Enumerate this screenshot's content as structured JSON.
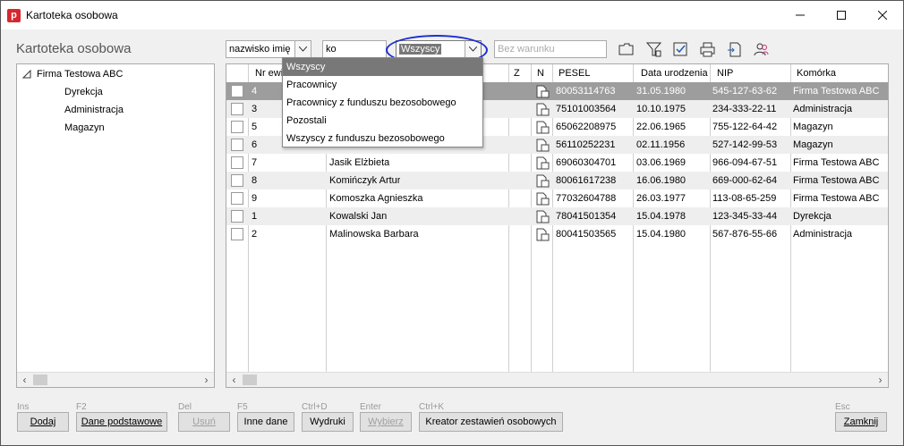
{
  "window": {
    "title": "Kartoteka osobowa"
  },
  "section_title": "Kartoteka osobowa",
  "filters": {
    "field_select": "nazwisko imię",
    "search_value": "ko",
    "group_select": "Wszyscy",
    "condition_placeholder": "Bez warunku"
  },
  "toolbar_icons": [
    "folder-icon",
    "filter-icon",
    "checkbox-icon",
    "print-icon",
    "export-icon",
    "users-icon"
  ],
  "tree": {
    "root": "Firma Testowa ABC",
    "children": [
      "Dyrekcja",
      "Administracja",
      "Magazyn"
    ]
  },
  "grid": {
    "columns": [
      "Nr ewid",
      "Z",
      "N",
      "PESEL",
      "Data urodzenia",
      "NIP",
      "Komórka"
    ],
    "rows": [
      {
        "nr": "4",
        "name": "",
        "pesel": "80053114763",
        "birth": "31.05.1980",
        "nip": "545-127-63-62",
        "unit": "Firma Testowa ABC"
      },
      {
        "nr": "3",
        "name": "",
        "pesel": "75101003564",
        "birth": "10.10.1975",
        "nip": "234-333-22-11",
        "unit": "Administracja"
      },
      {
        "nr": "5",
        "name": "",
        "pesel": "65062208975",
        "birth": "22.06.1965",
        "nip": "755-122-64-42",
        "unit": "Magazyn"
      },
      {
        "nr": "6",
        "name": "",
        "pesel": "56110252231",
        "birth": "02.11.1956",
        "nip": "527-142-99-53",
        "unit": "Magazyn"
      },
      {
        "nr": "7",
        "name": "Jasik Elżbieta",
        "pesel": "69060304701",
        "birth": "03.06.1969",
        "nip": "966-094-67-51",
        "unit": "Firma Testowa ABC"
      },
      {
        "nr": "8",
        "name": "Komińczyk Artur",
        "pesel": "80061617238",
        "birth": "16.06.1980",
        "nip": "669-000-62-64",
        "unit": "Firma Testowa ABC"
      },
      {
        "nr": "9",
        "name": "Komoszka Agnieszka",
        "pesel": "77032604788",
        "birth": "26.03.1977",
        "nip": "113-08-65-259",
        "unit": "Firma Testowa ABC"
      },
      {
        "nr": "1",
        "name": "Kowalski Jan",
        "pesel": "78041501354",
        "birth": "15.04.1978",
        "nip": "123-345-33-44",
        "unit": "Dyrekcja"
      },
      {
        "nr": "2",
        "name": "Malinowska Barbara",
        "pesel": "80041503565",
        "birth": "15.04.1980",
        "nip": "567-876-55-66",
        "unit": "Administracja"
      }
    ]
  },
  "dropdown": {
    "options": [
      "Wszyscy",
      "Pracownicy",
      "Pracownicy z funduszu bezosobowego",
      "Pozostali",
      "Wszyscy z funduszu bezosobowego"
    ],
    "selected": "Wszyscy"
  },
  "buttons": [
    {
      "key": "Ins",
      "label": "Dodaj",
      "disabled": false
    },
    {
      "key": "F2",
      "label": "Dane podstawowe",
      "disabled": false
    },
    {
      "key": "Del",
      "label": "Usuń",
      "disabled": true
    },
    {
      "key": "F5",
      "label": "Inne dane",
      "disabled": false
    },
    {
      "key": "Ctrl+D",
      "label": "Wydruki",
      "disabled": false
    },
    {
      "key": "Enter",
      "label": "Wybierz",
      "disabled": true
    },
    {
      "key": "Ctrl+K",
      "label": "Kreator zestawień osobowych",
      "disabled": false
    },
    {
      "key": "Esc",
      "label": "Zamknij",
      "disabled": false
    }
  ],
  "colors": {
    "selected_row": "#9d9d9d",
    "highlight": "#1b2fd0",
    "app_icon": "#d8262e"
  }
}
